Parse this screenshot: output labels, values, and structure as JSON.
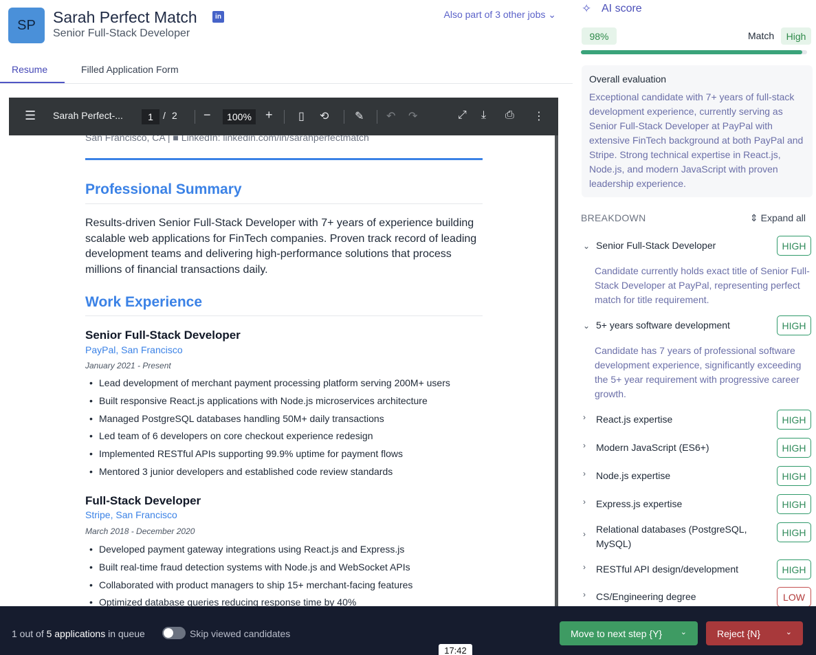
{
  "candidate": {
    "initials": "SP",
    "name": "Sarah Perfect Match",
    "title": "Senior Full-Stack Developer",
    "linkedin_icon": "linkedin-icon",
    "also_part_prefix": "Also part of ",
    "also_part_link": "3 other jobs"
  },
  "tabs": [
    {
      "label": "Resume",
      "active": true
    },
    {
      "label": "Filled Application Form",
      "active": false
    }
  ],
  "pdf": {
    "filename": "Sarah Perfect-...",
    "page_current": "1",
    "page_sep": "/",
    "page_total": "2",
    "zoom": "100%",
    "icons": [
      "menu-icon",
      "zoom-out-icon",
      "zoom-in-icon",
      "fit-page-icon",
      "rotate-icon",
      "annotate-icon",
      "undo-icon",
      "redo-icon",
      "fullscreen-icon",
      "download-icon",
      "print-icon",
      "more-icon"
    ],
    "resume": {
      "contact": "San Francisco, CA | ■ LinkedIn: linkedin.com/in/sarahperfectmatch",
      "summary_heading": "Professional Summary",
      "summary": "Results-driven Senior Full-Stack Developer with 7+ years of experience building scalable web applications for FinTech companies. Proven track record of leading development teams and delivering high-performance solutions that process millions of financial transactions daily.",
      "work_heading": "Work Experience",
      "jobs": [
        {
          "title": "Senior Full-Stack Developer",
          "company": "PayPal, San Francisco",
          "dates": "January 2021 - Present",
          "bullets": [
            "Lead development of merchant payment processing platform serving 200M+ users",
            "Built responsive React.js applications with Node.js microservices architecture",
            "Managed PostgreSQL databases handling 50M+ daily transactions",
            "Led team of 6 developers on core checkout experience redesign",
            "Implemented RESTful APIs supporting 99.9% uptime for payment flows",
            "Mentored 3 junior developers and established code review standards"
          ]
        },
        {
          "title": "Full-Stack Developer",
          "company": "Stripe, San Francisco",
          "dates": "March 2018 - December 2020",
          "bullets": [
            "Developed payment gateway integrations using React.js and Express.js",
            "Built real-time fraud detection systems with Node.js and WebSocket APIs",
            "Collaborated with product managers to ship 15+ merchant-facing features",
            "Optimized database queries reducing response time by 40%"
          ]
        }
      ]
    }
  },
  "ai": {
    "label": "AI score",
    "score": "98%",
    "score_fraction": 0.98,
    "match_label": "Match",
    "match_value": "High",
    "eval_title": "Overall evaluation",
    "eval_text": "Exceptional candidate with 7+ years of full-stack development experience, currently serving as Senior Full-Stack Developer at PayPal with extensive FinTech background at both PayPal and Stripe. Strong technical expertise in React.js, Node.js, and modern JavaScript with proven leadership experience.",
    "breakdown_label": "BREAKDOWN",
    "expand_all": "Expand all",
    "criteria": [
      {
        "name": "Senior Full-Stack Developer",
        "level": "HIGH",
        "expanded": true,
        "desc": "Candidate currently holds exact title of Senior Full-Stack Developer at PayPal, representing perfect match for title requirement."
      },
      {
        "name": "5+ years software development",
        "level": "HIGH",
        "expanded": true,
        "desc": "Candidate has 7 years of professional software development experience, significantly exceeding the 5+ year requirement with progressive career growth."
      },
      {
        "name": "React.js expertise",
        "level": "HIGH",
        "expanded": false
      },
      {
        "name": "Modern JavaScript (ES6+)",
        "level": "HIGH",
        "expanded": false
      },
      {
        "name": "Node.js expertise",
        "level": "HIGH",
        "expanded": false
      },
      {
        "name": "Express.js expertise",
        "level": "HIGH",
        "expanded": false
      },
      {
        "name": "Relational databases (PostgreSQL, MySQL)",
        "level": "HIGH",
        "expanded": false
      },
      {
        "name": "RESTful API design/development",
        "level": "HIGH",
        "expanded": false
      },
      {
        "name": "CS/Engineering degree",
        "level": "LOW",
        "expanded": false
      }
    ],
    "colors": {
      "high": "#2f9a6a",
      "low": "#c45050",
      "accent": "#5b62c9"
    }
  },
  "footer": {
    "queue_prefix": "1 out of ",
    "queue_bold": "5 applications",
    "queue_suffix": " in queue",
    "skip_label": "Skip viewed candidates",
    "next_button": "Move to next step {Y}",
    "reject_button": "Reject {N}",
    "time": "17:42"
  }
}
